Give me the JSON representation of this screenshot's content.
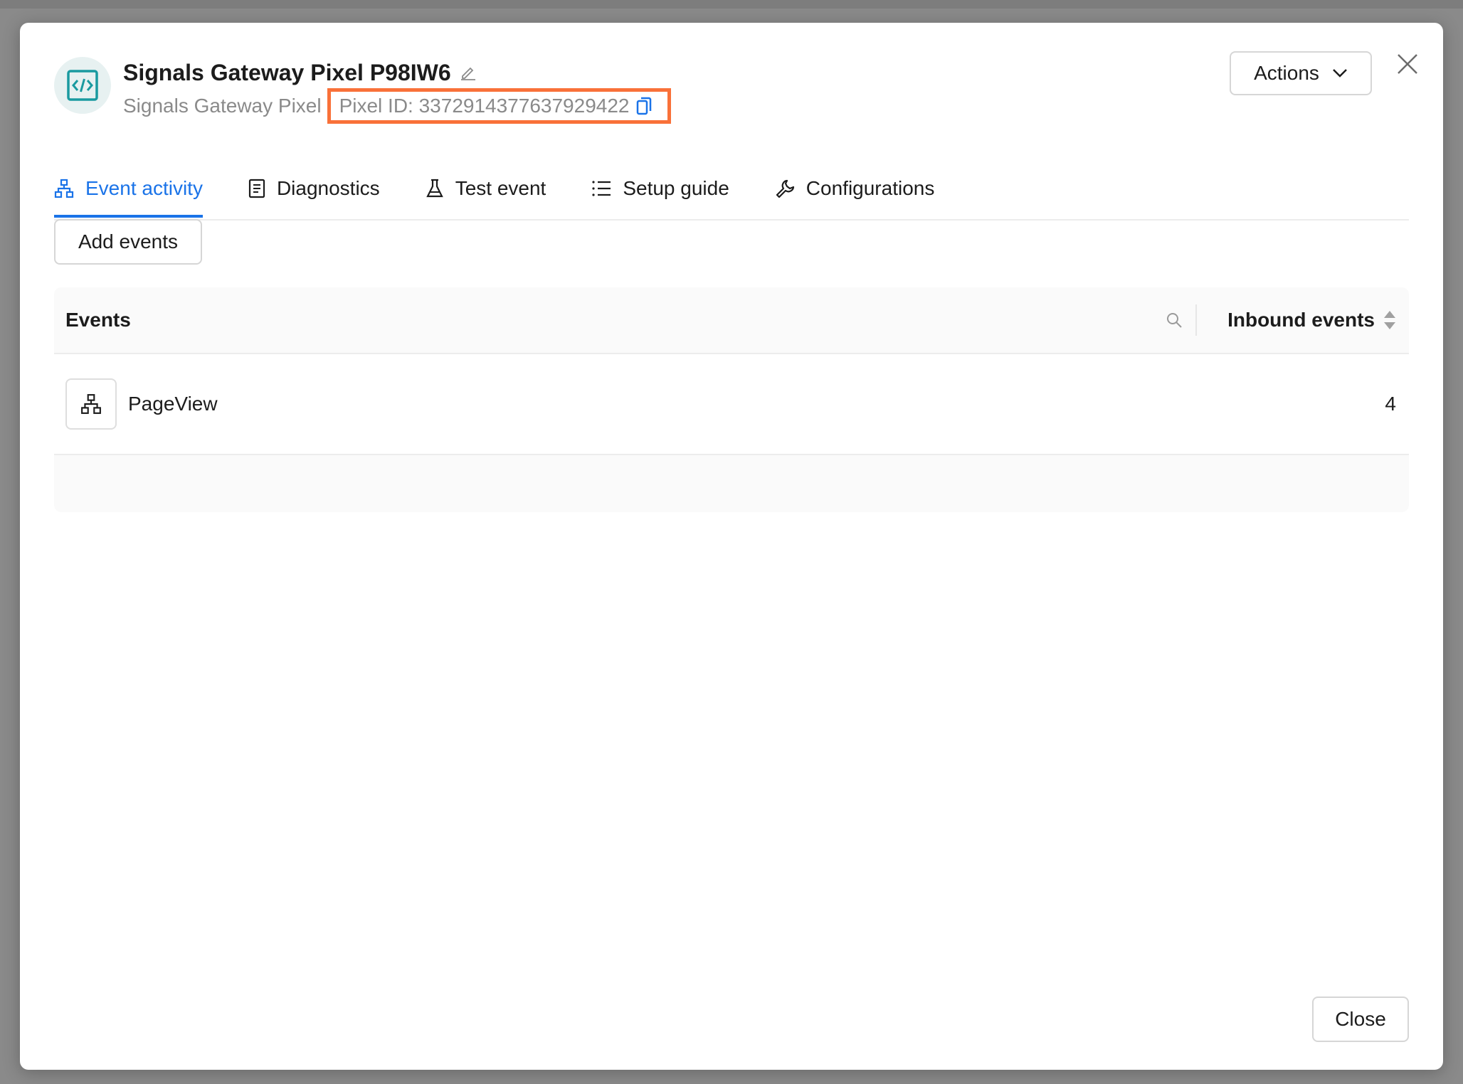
{
  "header": {
    "title": "Signals Gateway Pixel P98IW6",
    "subtitle_type": "Signals Gateway Pixel",
    "pixel_id_label": "Pixel ID: 3372914377637929422",
    "actions_label": "Actions"
  },
  "tabs": [
    {
      "label": "Event activity",
      "icon": "hierarchy-icon",
      "active": true
    },
    {
      "label": "Diagnostics",
      "icon": "document-icon",
      "active": false
    },
    {
      "label": "Test event",
      "icon": "flask-icon",
      "active": false
    },
    {
      "label": "Setup guide",
      "icon": "list-icon",
      "active": false
    },
    {
      "label": "Configurations",
      "icon": "wrench-icon",
      "active": false
    }
  ],
  "toolbar": {
    "add_events_label": "Add events"
  },
  "table": {
    "columns": {
      "events": "Events",
      "inbound": "Inbound events"
    },
    "rows": [
      {
        "name": "PageView",
        "count": "4",
        "icon": "hierarchy-icon"
      }
    ]
  },
  "footer": {
    "close_label": "Close"
  },
  "colors": {
    "accent": "#1a73e8",
    "highlight": "#f97139",
    "avatar_icon": "#1a9aa0"
  }
}
